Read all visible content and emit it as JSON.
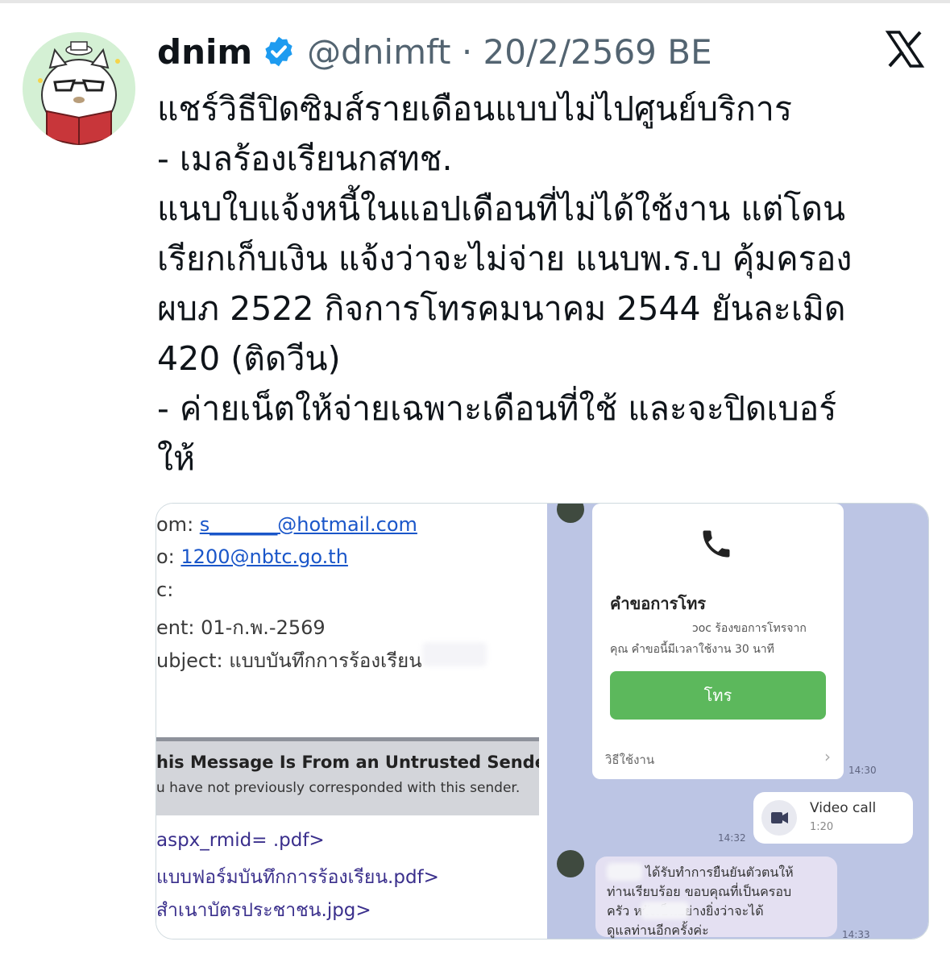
{
  "author": {
    "name": "dnim",
    "handle_date": "@dnimft · 20/2/2569 BE",
    "verified_icon": "verified-badge-icon",
    "avatar_icon": "cat-reading-avatar"
  },
  "tweet": {
    "lines": [
      "แชร์วิธีปิดซิมส์รายเดือนแบบไม่ไปศูนย์บริการ",
      "- เมลร้องเรียนกสทช.",
      "แนบใบแจ้งหนี้ในแอปเดือนที่ไม่ได้ใช้งาน แต่โดน",
      "เรียกเก็บเงิน แจ้งว่าจะไม่จ่าย แนบพ.ร.บ คุ้มครอง",
      "ผบภ 2522 กิจการโทรคมนาคม 2544 ยันละเมิด",
      "420 (ติดวีน)",
      "- ค่ายเน็ตให้จ่ายเฉพาะเดือนที่ใช้ และจะปิดเบอร์",
      "ให้"
    ]
  },
  "email": {
    "from_label": "om: ",
    "from_value": "s_______@hotmail.com",
    "to_label": "o: ",
    "to_value": "1200@nbtc.go.th",
    "cc_label": "c:",
    "sent": "ent: 01-ก.พ.-2569",
    "subject": "ubject: แบบบันทึกการร้องเรียน",
    "warning_title": "his Message Is From an Untrusted Sender",
    "warning_sub": "u have not previously corresponded with this sender.",
    "attachments": [
      "aspx_rmid=       .pdf>",
      "แบบฟอร์มบันทึกการร้องเรียน.pdf>",
      "สำเนาบัตรประชาชน.jpg>"
    ]
  },
  "chat": {
    "call_title": "คำขอการโทร",
    "call_sub1": "ɔoc ร้องขอการโทรจาก",
    "call_sub2": "คุณ คำขอนี้มีเวลาใช้งาน 30 นาที",
    "call_button": "โทร",
    "howto": "วิธีใช้งาน",
    "ts1": "14:30",
    "ts2": "14:32",
    "ts3": "14:33",
    "video_title": "Video call",
    "video_duration": "1:20",
    "message_lines": [
      "ได้รับทำการยืนยันตัวตนให้",
      "ท่านเรียบร้อย ขอบคุณที่เป็นครอบ",
      "ครัว          หวังเป็นอย่างยิ่งว่าจะได้",
      "ดูแลท่านอีกครั้งค่ะ"
    ]
  },
  "colors": {
    "verified": "#1d9bf0",
    "link": "#1a56c9",
    "call_button": "#5cb85c",
    "chat_bg": "#bcc5e4"
  }
}
